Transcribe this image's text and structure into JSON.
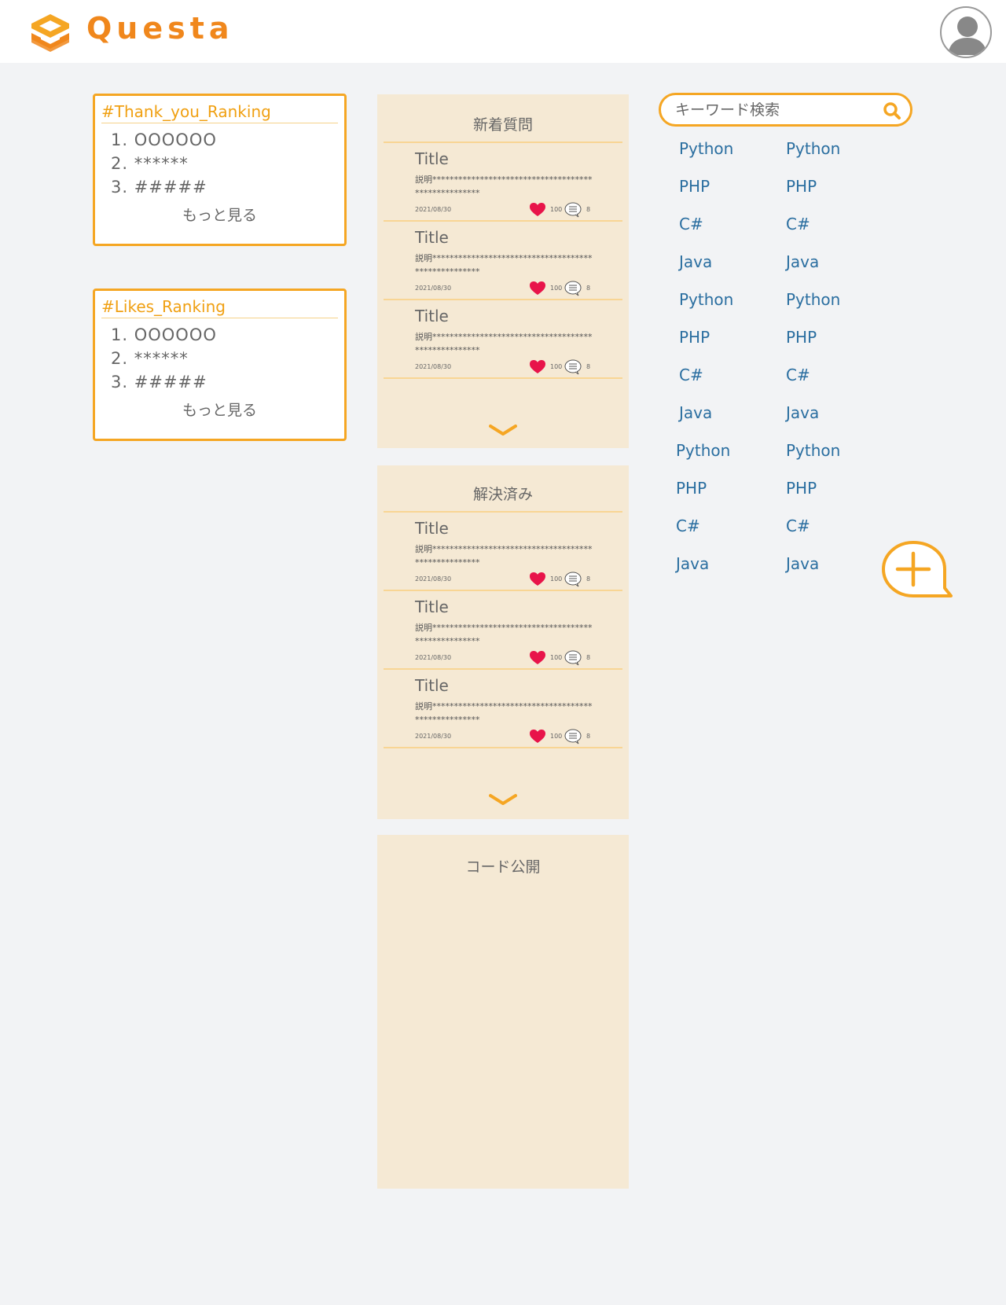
{
  "header": {
    "brand": "Questa",
    "logo_icon": "questa-logo-icon",
    "avatar_icon": "user-avatar-icon"
  },
  "colors": {
    "accent": "#f5a623",
    "brand": "#f0871c",
    "panel_bg": "#f5e9d4",
    "tag_link": "#2a6ea0",
    "heart": "#e8144a"
  },
  "thanks_ranking": {
    "title": "#Thank_you_Ranking",
    "items": [
      "1. OOOOOO",
      "2. ******",
      "3. #####"
    ],
    "more": "もっと見る"
  },
  "likes_ranking": {
    "title": "#Likes_Ranking",
    "items": [
      "1. OOOOOO",
      "2. ******",
      "3. #####"
    ],
    "more": "もっと見る"
  },
  "new_questions": {
    "title": "新着質問",
    "items": [
      {
        "title": "Title",
        "desc": "説明****************************************************",
        "date": "2021/08/30",
        "likes": "100",
        "comments": "8"
      },
      {
        "title": "Title",
        "desc": "説明****************************************************",
        "date": "2021/08/30",
        "likes": "100",
        "comments": "8"
      },
      {
        "title": "Title",
        "desc": "説明****************************************************",
        "date": "2021/08/30",
        "likes": "100",
        "comments": "8"
      }
    ]
  },
  "solved": {
    "title": "解決済み",
    "items": [
      {
        "title": "Title",
        "desc": "説明****************************************************",
        "date": "2021/08/30",
        "likes": "100",
        "comments": "8"
      },
      {
        "title": "Title",
        "desc": "説明****************************************************",
        "date": "2021/08/30",
        "likes": "100",
        "comments": "8"
      },
      {
        "title": "Title",
        "desc": "説明****************************************************",
        "date": "2021/08/30",
        "likes": "100",
        "comments": "8"
      }
    ]
  },
  "code_public": {
    "title": "コード公開"
  },
  "search": {
    "placeholder": "キーワード検索",
    "icon": "search-icon"
  },
  "tags": {
    "left": [
      "Python",
      "PHP",
      "C#",
      "Java",
      "Python",
      "PHP",
      "C#",
      "Java",
      "Python",
      "PHP",
      "C#",
      "Java"
    ],
    "right": [
      "Python",
      "PHP",
      "C#",
      "Java",
      "Python",
      "PHP",
      "C#",
      "Java",
      "Python",
      "PHP",
      "C#",
      "Java"
    ]
  },
  "fab": {
    "icon": "add-question-icon"
  }
}
